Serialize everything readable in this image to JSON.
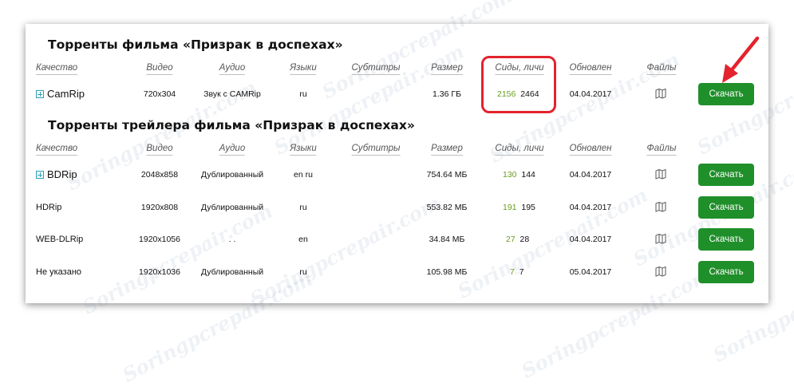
{
  "sections": [
    {
      "title": "Торренты фильма «Призрак в доспехах»",
      "headers": {
        "quality": "Качество",
        "video": "Видео",
        "audio": "Аудио",
        "languages": "Языки",
        "subtitles": "Субтитры",
        "size": "Размер",
        "seeds_peers": "Сиды, личи",
        "updated": "Обновлен",
        "files": "Файлы"
      },
      "rows": [
        {
          "quality": "CamRip",
          "video": "720x304",
          "audio": "Звук с CAMRip",
          "languages": "ru",
          "subtitles": "",
          "size": "1.36 ГБ",
          "seeds": "2156",
          "peers": "2464",
          "updated": "04.04.2017",
          "download": "Скачать",
          "expandable": true
        }
      ]
    },
    {
      "title": "Торренты трейлера фильма «Призрак в доспехах»",
      "headers": {
        "quality": "Качество",
        "video": "Видео",
        "audio": "Аудио",
        "languages": "Языки",
        "subtitles": "Субтитры",
        "size": "Размер",
        "seeds_peers": "Сиды, личи",
        "updated": "Обновлен",
        "files": "Файлы"
      },
      "rows": [
        {
          "quality": "BDRip",
          "video": "2048x858",
          "audio": "Дублированный",
          "languages": "en ru",
          "subtitles": "",
          "size": "754.64 МБ",
          "seeds": "130",
          "peers": "144",
          "updated": "04.04.2017",
          "download": "Скачать",
          "expandable": true
        },
        {
          "quality": "HDRip",
          "video": "1920x808",
          "audio": "Дублированный",
          "languages": "ru",
          "subtitles": "",
          "size": "553.82 МБ",
          "seeds": "191",
          "peers": "195",
          "updated": "04.04.2017",
          "download": "Скачать",
          "expandable": false
        },
        {
          "quality": "WEB-DLRip",
          "video": "1920x1056",
          "audio": ". .",
          "languages": "en",
          "subtitles": "",
          "size": "34.84 МБ",
          "seeds": "27",
          "peers": "28",
          "updated": "04.04.2017",
          "download": "Скачать",
          "expandable": false
        },
        {
          "quality": "Не указано",
          "video": "1920x1036",
          "audio": "Дублированный",
          "languages": "ru",
          "subtitles": "",
          "size": "105.98 МБ",
          "seeds": "7",
          "peers": "7",
          "updated": "05.04.2017",
          "download": "Скачать",
          "expandable": false
        }
      ]
    }
  ],
  "icons": {
    "files": "map-icon",
    "expand": "plus-square-icon",
    "annotation": "red-arrow-icon"
  },
  "colors": {
    "download_button": "#1f8f2a",
    "seeds": "#6a9e1f",
    "highlight": "#e3232e",
    "expand_icon": "#2a9fb4"
  },
  "watermark": "Soringpcrepair.com"
}
